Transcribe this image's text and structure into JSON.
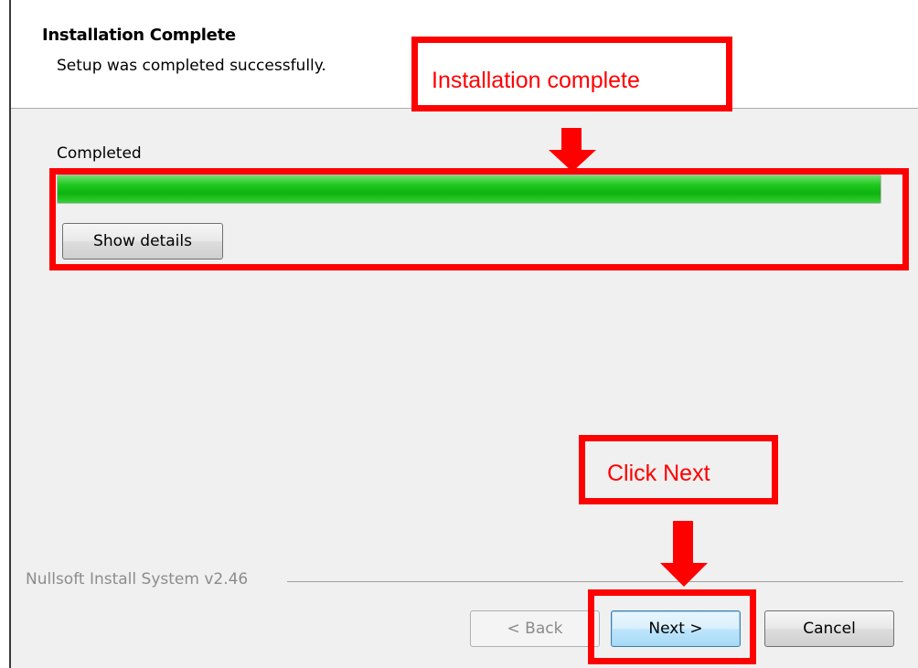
{
  "header": {
    "title": "Installation Complete",
    "subtitle": "Setup was completed successfully."
  },
  "progress": {
    "status_label": "Completed",
    "value_percent": 100,
    "show_details_label": "Show details"
  },
  "footer": {
    "branding": "Nullsoft Install System v2.46",
    "back_label": "< Back",
    "next_label": "Next >",
    "cancel_label": "Cancel"
  },
  "annotations": {
    "installation_complete": "Installation complete",
    "click_next": "Click Next"
  },
  "colors": {
    "progress_green": "#1ec81e",
    "annotation_red": "#ff0000"
  }
}
